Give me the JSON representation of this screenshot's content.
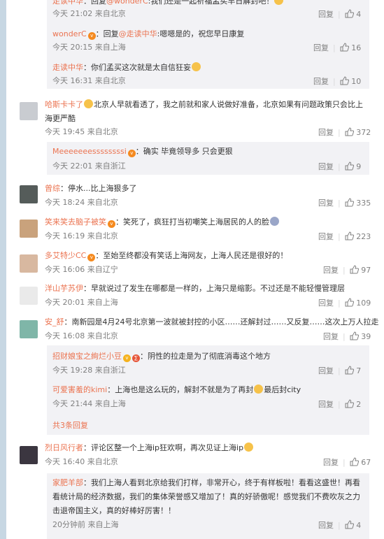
{
  "reply_label": "回复",
  "thread1": {
    "top": {
      "name": "走读中华",
      "to": "@wonderC",
      "text": "我们还是一起祈福孟买早日解封吧！",
      "time": "今天 21:02 来自北京",
      "likes": "4"
    },
    "r1": {
      "name": "wonderC",
      "reply_word": "回复",
      "to": "@走读中华",
      "text": ":嗯嗯是的，祝您早日康复",
      "time": "今天 20:15 来自上海",
      "likes": "16"
    },
    "r2": {
      "name": "走读中华",
      "text": "：你们孟买这次就是太自信狂妄",
      "time": "今天 16:31 来自北京",
      "likes": "10"
    }
  },
  "c1": {
    "name": "哈斯卡卡了",
    "text1": "北京人早就看透了，我之前就和家人说做好准备，北京如果有问题政策只会比上",
    "text2": "海更严酷",
    "time": "今天 19:45 来自北京",
    "likes": "372",
    "reply": {
      "name": "Meeeeeeessssssssi",
      "text": "：确实 毕竟领导多 只会更狠",
      "time": "今天 22:01 来自浙江",
      "likes": "9"
    }
  },
  "c2": {
    "name": "曾综",
    "text": "：停水...比上海狠多了",
    "time": "今天 18:24 来自北京",
    "likes": "335"
  },
  "c3": {
    "name": "笑来笑去脑子被笑",
    "text": "：笑死了，疯狂打当初嘲笑上海居民的人的脸",
    "time": "今天 16:19 来自北京",
    "likes": "223"
  },
  "c4": {
    "name": "多艾特少CC",
    "text": "：至始至终都没有笑话上海网友，上海人民还是很好的！",
    "time": "今天 16:06 来自辽宁",
    "likes": "97"
  },
  "c5": {
    "name": "洋山芋苏伊",
    "text": "：早就说过了发生在哪都是一样的，上海只是缩影。不过还是不能轻慢管理层",
    "time": "今天 20:01 来自上海",
    "likes": "109"
  },
  "c6": {
    "name": "安_舒",
    "text": "：南新园是4月24号北京第一波就被封控的小区……还解封过……又反复……这次上万人拉走",
    "time": "今天 16:08 来自北京",
    "likes": "39",
    "r1": {
      "name": "招财娘宝之絢烂小豆",
      "text": "：阴性的拉走是为了彻底消毒这个地方",
      "time": "今天 19:28 来自浙江",
      "likes": "7"
    },
    "r2": {
      "name": "可爱害羞的kimi",
      "text": "：上海也是这么玩的，解封不就是为了再封",
      "text_end": "最后封city",
      "time": "今天 21:44 来自上海",
      "likes": "2"
    },
    "more": "共3条回复"
  },
  "c7": {
    "name": "烈日风行者",
    "text": "：评论区整一个上海ip狂欢啊，再次见证上海ip",
    "time": "今天 16:40 来自北京",
    "likes": "67",
    "reply": {
      "name": "家肥羊部",
      "text": "：我们上海人看到北京给我们打样，非常开心，终于有样板啦！看看这盛世！再看看统计局的经济数据，我们的集体荣誉感又增加了！真的好骄傲呢！感觉我们不费吹灰之力击退帝国主义，真的好棒好厉害！！",
      "time": "20分钟前 来自上海",
      "likes": "4"
    }
  }
}
